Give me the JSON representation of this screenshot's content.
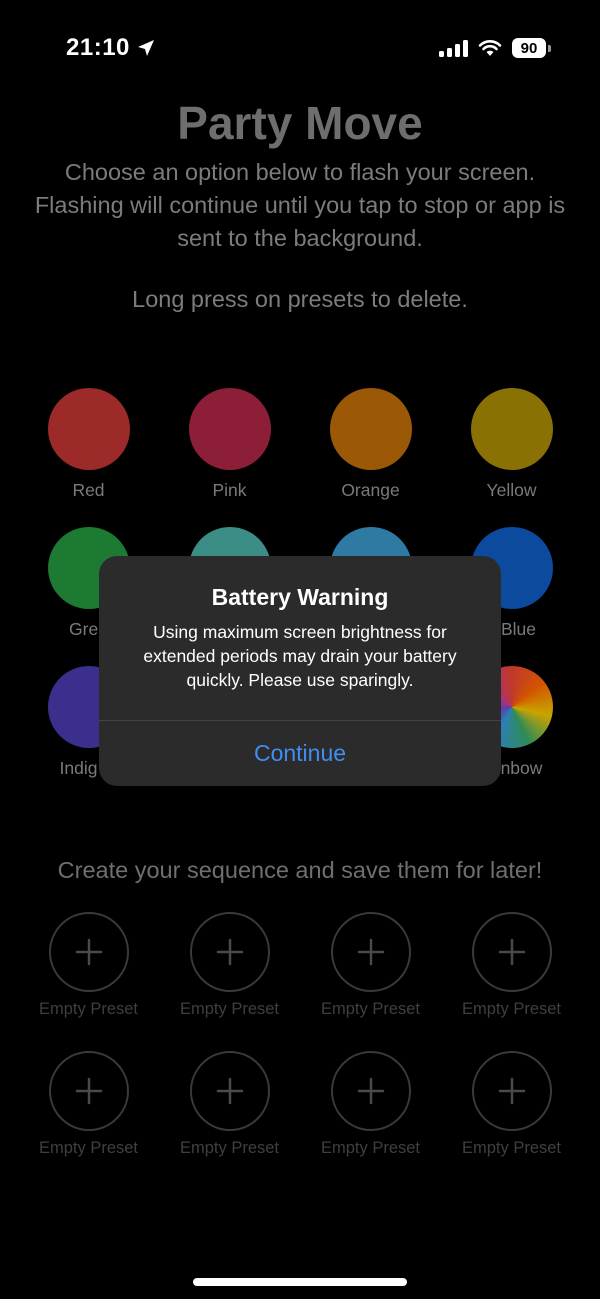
{
  "status": {
    "time": "21:10",
    "battery": "90"
  },
  "app": {
    "title": "Party Move",
    "description": "Choose an option below to flash your screen. Flashing will continue until you tap to stop or app is sent to the background.",
    "hint": "Long press on presets to delete."
  },
  "colors": [
    {
      "label": "Red",
      "color": "#9c2a28"
    },
    {
      "label": "Pink",
      "color": "#8c1f37"
    },
    {
      "label": "Orange",
      "color": "#9b5908"
    },
    {
      "label": "Yellow",
      "color": "#8a7104"
    },
    {
      "label": "Gree",
      "color": "#1c7a33"
    },
    {
      "label": "",
      "color": "#3b8d86"
    },
    {
      "label": "",
      "color": "#2e7aa3"
    },
    {
      "label": "Blue",
      "color": "#0b4a9c"
    },
    {
      "label": "Indig",
      "color": "#3a2f8c"
    },
    {
      "label": "",
      "color": "#1a1a1a"
    },
    {
      "label": "",
      "color": "#1a1a1a"
    },
    {
      "label": "nbow",
      "color": "rainbow"
    }
  ],
  "sequence": {
    "title": "Create your sequence and save them for later!",
    "presets": [
      "Empty Preset",
      "Empty Preset",
      "Empty Preset",
      "Empty Preset",
      "Empty Preset",
      "Empty Preset",
      "Empty Preset",
      "Empty Preset"
    ]
  },
  "alert": {
    "title": "Battery Warning",
    "message": "Using maximum screen brightness for extended periods may drain your battery quickly. Please use sparingly.",
    "button": "Continue"
  }
}
